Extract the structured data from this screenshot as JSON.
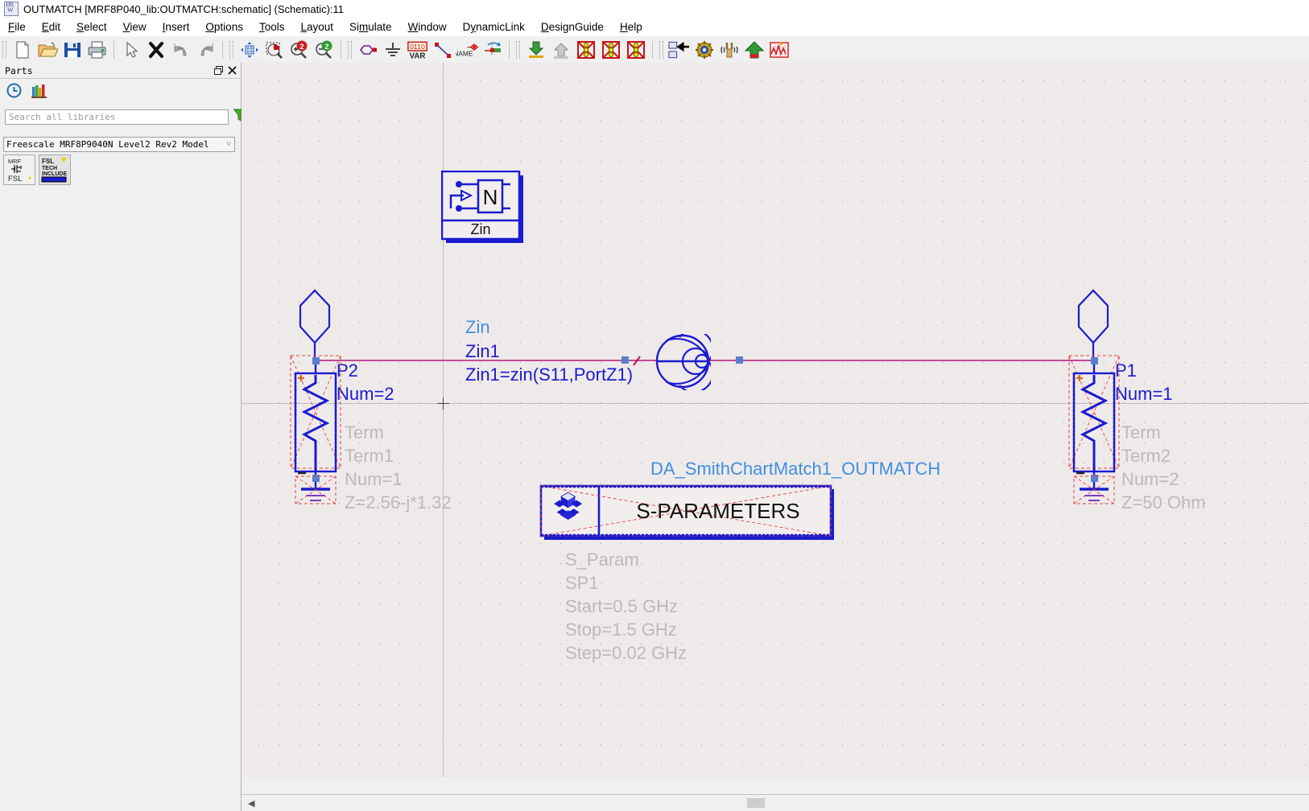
{
  "window": {
    "title": "OUTMATCH [MRF8P040_lib:OUTMATCH:schematic] (Schematic):11",
    "app_icon": "adsapp-icon"
  },
  "menubar": {
    "items": [
      {
        "label": "File",
        "mnemonic": "F"
      },
      {
        "label": "Edit",
        "mnemonic": "E"
      },
      {
        "label": "Select",
        "mnemonic": "S"
      },
      {
        "label": "View",
        "mnemonic": "V"
      },
      {
        "label": "Insert",
        "mnemonic": "I"
      },
      {
        "label": "Options",
        "mnemonic": "O"
      },
      {
        "label": "Tools",
        "mnemonic": "T"
      },
      {
        "label": "Layout",
        "mnemonic": "L"
      },
      {
        "label": "Simulate",
        "mnemonic": "m"
      },
      {
        "label": "Window",
        "mnemonic": "W"
      },
      {
        "label": "DynamicLink",
        "mnemonic": "y"
      },
      {
        "label": "DesignGuide",
        "mnemonic": "D"
      },
      {
        "label": "Help",
        "mnemonic": "H"
      }
    ]
  },
  "toolbar": {
    "groups": [
      [
        "new-document-icon",
        "open-folder-icon",
        "save-disk-icon",
        "print-icon"
      ],
      [
        "select-arrow-icon",
        "delete-x-icon",
        "undo-icon",
        "redo-icon"
      ],
      [
        "zoom-fit-icon",
        "zoom-area-icon",
        "zoom-in-icon",
        "zoom-out-icon"
      ],
      [
        "insert-component-icon",
        "insert-ground-icon",
        "insert-var-icon",
        "insert-wire-icon",
        "insert-wire-name-icon",
        "insert-pin-icon"
      ],
      [
        "push-into-hierarchy-icon",
        "pop-out-hierarchy-icon",
        "deactivate-component-icon",
        "deactivate-all-icon",
        "activate-all-icon"
      ],
      [
        "toggle-schematic-layout-icon",
        "tune-parameters-icon",
        "tuning-fork-icon",
        "simulate-icon",
        "data-display-icon"
      ]
    ]
  },
  "parts_panel": {
    "title": "Parts",
    "restore_icon": "restore-window-icon",
    "close_icon": "close-icon",
    "history_icon": "history-clock-icon",
    "library_icon": "library-books-icon",
    "search": {
      "placeholder": "Search all libraries",
      "value": "",
      "filter_icon": "filter-funnel-icon"
    },
    "library_select": {
      "value": "Freescale MRF8P9040N Level2 Rev2 Model",
      "chevron_icon": "chevron-down-icon"
    },
    "part_items": [
      {
        "name": "mrf-fsl-part",
        "line1": "MRF",
        "line2": "FSL"
      },
      {
        "name": "fsl-tech-include-part",
        "line1": "FSL",
        "line2": "TECH",
        "line3": "INCLUDE"
      }
    ]
  },
  "schematic": {
    "zin_block": {
      "symbol_letter": "N",
      "symbol_caption": "Zin",
      "label_type": "Zin",
      "label_instance": "Zin1",
      "label_equation": "Zin1=zin(S11,PortZ1)"
    },
    "port_left": {
      "name": "P2",
      "num": "Num=2"
    },
    "term_left": {
      "type": "Term",
      "instance": "Term1",
      "num": "Num=1",
      "impedance": "Z=2.56-j*1.32"
    },
    "port_right": {
      "name": "P1",
      "num": "Num=1"
    },
    "term_right": {
      "type": "Term",
      "instance": "Term2",
      "num": "Num=2",
      "impedance": "Z=50 Ohm"
    },
    "smith_block": {
      "icon": "smith-chart-icon",
      "label_type": "DA_SmithChartMatch1_OUTMATCH",
      "label_instance": "DA_SmithChartMatch1"
    },
    "sparam_block": {
      "icon": "gear-cube-icon",
      "title": "S-PARAMETERS",
      "label_type": "S_Param",
      "label_instance": "SP1",
      "start": "Start=0.5 GHz",
      "stop": "Stop=1.5 GHz",
      "step": "Step=0.02 GHz"
    }
  },
  "colors": {
    "canvas_bg": "#efeaea",
    "component_blue": "#1b1bcf",
    "wire_magenta": "#b4147a",
    "label_cyan": "#3f8fe0",
    "label_gray": "#bdb9b9",
    "selection_red": "#e04040"
  },
  "statusbar": {
    "scroll_left_icon": "scroll-left-arrow-icon"
  }
}
